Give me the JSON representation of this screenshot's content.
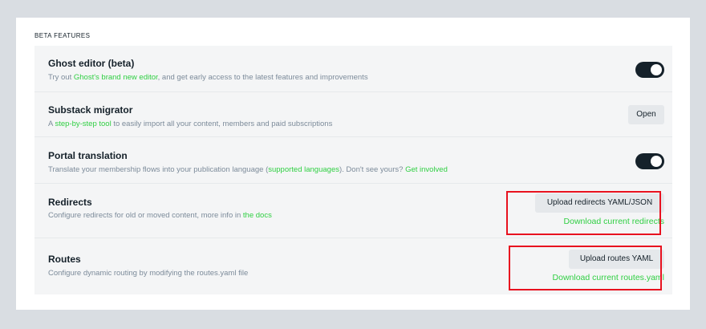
{
  "section": {
    "title": "BETA FEATURES"
  },
  "rows": {
    "ghost_editor": {
      "title": "Ghost editor (beta)",
      "desc_prefix": "Try out ",
      "desc_link": "Ghost's brand new editor",
      "desc_suffix": ", and get early access to the latest features and improvements",
      "toggle_on": true
    },
    "substack": {
      "title": "Substack migrator",
      "desc_prefix": "A ",
      "desc_link": "step-by-step tool",
      "desc_suffix": " to easily import all your content, members and paid subscriptions",
      "button_label": "Open"
    },
    "portal": {
      "title": "Portal translation",
      "desc_prefix": "Translate your membership flows into your publication language (",
      "desc_link": "supported languages",
      "desc_middle": "). Don't see yours? ",
      "desc_link2": "Get involved",
      "toggle_on": true
    },
    "redirects": {
      "title": "Redirects",
      "desc_prefix": "Configure redirects for old or moved content, more info in ",
      "desc_link": "the docs",
      "upload_label": "Upload redirects YAML/JSON",
      "download_label": "Download current redirects"
    },
    "routes": {
      "title": "Routes",
      "desc": "Configure dynamic routing by modifying the routes.yaml file",
      "upload_label": "Upload routes YAML",
      "download_label": "Download current routes.yaml"
    }
  },
  "colors": {
    "accent_green": "#30cf43",
    "highlight_red": "#e8121f",
    "toggle_dark": "#15212a"
  },
  "icons": {
    "toggle": "toggle-switch-icon"
  }
}
